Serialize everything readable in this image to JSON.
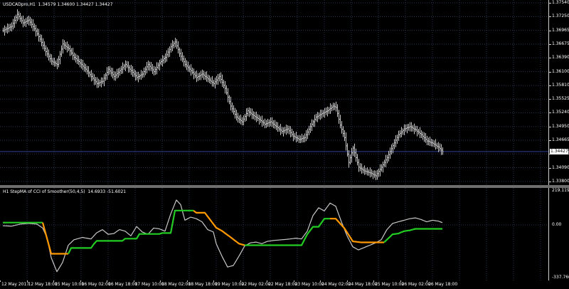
{
  "main_pane": {
    "title": "USDCADpro,H1  1.34579 1.34600 1.34427 1.34427",
    "current_price": "1.34427",
    "price_min": 1.338,
    "price_max": 1.3754,
    "scale_labels": [
      "1.37540",
      "1.37250",
      "1.36965",
      "1.36675",
      "1.36390",
      "1.36100",
      "1.35810",
      "1.35525",
      "1.35240",
      "1.34950",
      "1.34665",
      "1.34380",
      "1.34090",
      "1.33800"
    ]
  },
  "indicator_pane": {
    "title": "H1 StepMA of CCI of Smoother(50,4,5)  14.6933 -51.6021",
    "value_max": 219.1197,
    "value_min": -337.7608,
    "scale_labels": [
      "219.1197",
      "0.00",
      "-337.7608"
    ]
  },
  "time_axis": {
    "labels": [
      "12 May 2017",
      "12 May 18:00",
      "15 May 10:00",
      "16 May 02:00",
      "16 May 18:00",
      "17 May 10:00",
      "18 May 02:00",
      "18 May 18:00",
      "19 May 10:00",
      "22 May 02:00",
      "22 May 18:00",
      "23 May 10:00",
      "24 May 02:00",
      "24 May 18:00",
      "25 May 10:00",
      "26 May 02:00",
      "26 May 18:00"
    ]
  },
  "colors": {
    "background": "#000000",
    "bars": "#c8c8c8",
    "grid": "#2a3350",
    "bid_line": "#2f3f8f",
    "cci_line": "#c8c8c8",
    "step_up": "#22cc22",
    "step_down": "#ff9900"
  },
  "chart_data": [
    {
      "type": "ohlc",
      "title": "USDCADpro,H1",
      "y_range": [
        1.338,
        1.3754
      ],
      "close_anchors": [
        [
          0,
          1.3696
        ],
        [
          6,
          1.3705
        ],
        [
          10,
          1.373
        ],
        [
          14,
          1.3712
        ],
        [
          18,
          1.3718
        ],
        [
          22,
          1.37
        ],
        [
          26,
          1.3678
        ],
        [
          30,
          1.3652
        ],
        [
          34,
          1.3632
        ],
        [
          38,
          1.3625
        ],
        [
          42,
          1.3668
        ],
        [
          46,
          1.3658
        ],
        [
          50,
          1.364
        ],
        [
          54,
          1.3628
        ],
        [
          58,
          1.3615
        ],
        [
          62,
          1.36
        ],
        [
          66,
          1.3585
        ],
        [
          70,
          1.359
        ],
        [
          74,
          1.3615
        ],
        [
          78,
          1.36
        ],
        [
          82,
          1.3612
        ],
        [
          86,
          1.3625
        ],
        [
          90,
          1.3612
        ],
        [
          94,
          1.3598
        ],
        [
          98,
          1.3605
        ],
        [
          102,
          1.3625
        ],
        [
          106,
          1.361
        ],
        [
          110,
          1.3628
        ],
        [
          114,
          1.364
        ],
        [
          118,
          1.3662
        ],
        [
          121,
          1.3672
        ],
        [
          124,
          1.3648
        ],
        [
          128,
          1.3625
        ],
        [
          132,
          1.3612
        ],
        [
          136,
          1.3598
        ],
        [
          140,
          1.3605
        ],
        [
          144,
          1.3595
        ],
        [
          148,
          1.3585
        ],
        [
          152,
          1.36
        ],
        [
          156,
          1.3575
        ],
        [
          160,
          1.3538
        ],
        [
          164,
          1.3515
        ],
        [
          168,
          1.3505
        ],
        [
          172,
          1.3528
        ],
        [
          176,
          1.3518
        ],
        [
          180,
          1.351
        ],
        [
          184,
          1.35
        ],
        [
          188,
          1.3505
        ],
        [
          192,
          1.3495
        ],
        [
          196,
          1.3485
        ],
        [
          200,
          1.349
        ],
        [
          204,
          1.3475
        ],
        [
          208,
          1.3468
        ],
        [
          212,
          1.3472
        ],
        [
          216,
          1.3495
        ],
        [
          220,
          1.3515
        ],
        [
          224,
          1.3522
        ],
        [
          228,
          1.3528
        ],
        [
          232,
          1.3538
        ],
        [
          234,
          1.3535
        ],
        [
          237,
          1.3498
        ],
        [
          240,
          1.3472
        ],
        [
          243,
          1.342
        ],
        [
          246,
          1.345
        ],
        [
          250,
          1.341
        ],
        [
          254,
          1.3402
        ],
        [
          258,
          1.3398
        ],
        [
          262,
          1.3392
        ],
        [
          266,
          1.341
        ],
        [
          270,
          1.343
        ],
        [
          274,
          1.3455
        ],
        [
          278,
          1.3478
        ],
        [
          282,
          1.349
        ],
        [
          286,
          1.3495
        ],
        [
          290,
          1.3488
        ],
        [
          294,
          1.3478
        ],
        [
          298,
          1.3465
        ],
        [
          302,
          1.346
        ],
        [
          306,
          1.3452
        ],
        [
          309,
          1.34427
        ]
      ]
    },
    {
      "type": "line",
      "title": "H1 StepMA of CCI of Smoother(50,4,5)",
      "y_range": [
        -337.7608,
        219.1197
      ],
      "series": [
        {
          "name": "CCI of Smoother",
          "points": [
            [
              0,
              -5
            ],
            [
              6,
              -8
            ],
            [
              12,
              5
            ],
            [
              18,
              10
            ],
            [
              24,
              5
            ],
            [
              28,
              -20
            ],
            [
              31,
              -80
            ],
            [
              34,
              -210
            ],
            [
              38,
              -300
            ],
            [
              42,
              -240
            ],
            [
              46,
              -130
            ],
            [
              50,
              -95
            ],
            [
              56,
              -80
            ],
            [
              62,
              -90
            ],
            [
              66,
              -50
            ],
            [
              70,
              -30
            ],
            [
              74,
              -60
            ],
            [
              78,
              -55
            ],
            [
              82,
              -30
            ],
            [
              86,
              -40
            ],
            [
              90,
              -70
            ],
            [
              94,
              -10
            ],
            [
              98,
              -45
            ],
            [
              102,
              -60
            ],
            [
              106,
              -20
            ],
            [
              110,
              -25
            ],
            [
              114,
              -40
            ],
            [
              118,
              70
            ],
            [
              122,
              160
            ],
            [
              125,
              130
            ],
            [
              128,
              30
            ],
            [
              132,
              50
            ],
            [
              136,
              40
            ],
            [
              140,
              20
            ],
            [
              144,
              -30
            ],
            [
              148,
              -45
            ],
            [
              150,
              -120
            ],
            [
              154,
              -200
            ],
            [
              158,
              -270
            ],
            [
              162,
              -260
            ],
            [
              166,
              -200
            ],
            [
              170,
              -135
            ],
            [
              174,
              -115
            ],
            [
              178,
              -110
            ],
            [
              182,
              -120
            ],
            [
              186,
              -105
            ],
            [
              190,
              -100
            ],
            [
              196,
              -95
            ],
            [
              202,
              -90
            ],
            [
              206,
              -85
            ],
            [
              210,
              -90
            ],
            [
              214,
              -40
            ],
            [
              218,
              60
            ],
            [
              222,
              110
            ],
            [
              226,
              90
            ],
            [
              230,
              140
            ],
            [
              234,
              120
            ],
            [
              238,
              20
            ],
            [
              242,
              -70
            ],
            [
              246,
              -140
            ],
            [
              250,
              -160
            ],
            [
              254,
              -145
            ],
            [
              258,
              -130
            ],
            [
              262,
              -115
            ],
            [
              266,
              -95
            ],
            [
              270,
              -30
            ],
            [
              274,
              10
            ],
            [
              278,
              20
            ],
            [
              282,
              30
            ],
            [
              286,
              40
            ],
            [
              290,
              45
            ],
            [
              294,
              35
            ],
            [
              298,
              20
            ],
            [
              302,
              30
            ],
            [
              306,
              25
            ],
            [
              309,
              15
            ]
          ]
        },
        {
          "name": "StepMA",
          "points": [
            [
              0,
              15
            ],
            [
              28,
              15
            ],
            [
              34,
              -185
            ],
            [
              38,
              -185
            ],
            [
              46,
              -185
            ],
            [
              48,
              -148
            ],
            [
              62,
              -148
            ],
            [
              64,
              -122
            ],
            [
              66,
              -102
            ],
            [
              84,
              -102
            ],
            [
              86,
              -88
            ],
            [
              94,
              -88
            ],
            [
              96,
              -58
            ],
            [
              110,
              -58
            ],
            [
              112,
              -52
            ],
            [
              118,
              -52
            ],
            [
              121,
              92
            ],
            [
              134,
              92
            ],
            [
              136,
              78
            ],
            [
              142,
              78
            ],
            [
              150,
              -18
            ],
            [
              154,
              -38
            ],
            [
              160,
              -78
            ],
            [
              166,
              -120
            ],
            [
              170,
              -130
            ],
            [
              210,
              -130
            ],
            [
              214,
              -60
            ],
            [
              218,
              -12
            ],
            [
              222,
              -12
            ],
            [
              226,
              40
            ],
            [
              230,
              40
            ],
            [
              234,
              40
            ],
            [
              240,
              -20
            ],
            [
              246,
              -105
            ],
            [
              252,
              -112
            ],
            [
              268,
              -112
            ],
            [
              274,
              -60
            ],
            [
              278,
              -55
            ],
            [
              282,
              -40
            ],
            [
              286,
              -35
            ],
            [
              290,
              -25
            ],
            [
              309,
              -25
            ]
          ],
          "down_ranges": [
            [
              28,
              46
            ],
            [
              134,
              170
            ],
            [
              230,
              268
            ]
          ]
        }
      ]
    }
  ]
}
